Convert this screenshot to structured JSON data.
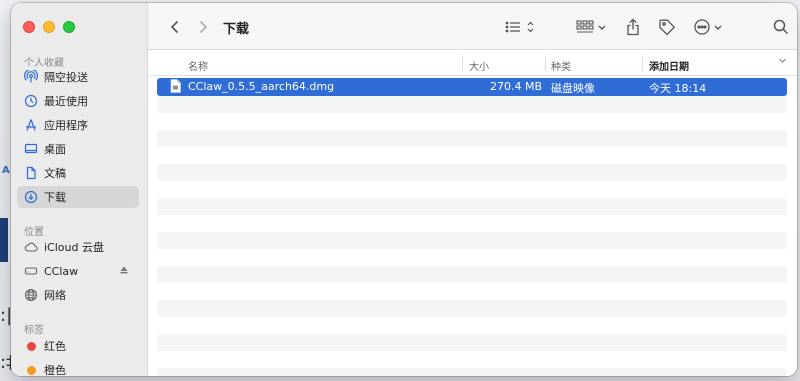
{
  "window": {
    "title": "下载",
    "back_icon": "chevron-left-icon",
    "forward_icon": "chevron-right-icon"
  },
  "sidebar": {
    "favorites_title": "个人收藏",
    "favorites": [
      {
        "label": "隔空投送",
        "icon": "airdrop-icon"
      },
      {
        "label": "最近使用",
        "icon": "clock-icon"
      },
      {
        "label": "应用程序",
        "icon": "applications-icon"
      },
      {
        "label": "桌面",
        "icon": "desktop-icon"
      },
      {
        "label": "文稿",
        "icon": "document-icon"
      },
      {
        "label": "下载",
        "icon": "download-icon",
        "selected": true
      }
    ],
    "locations_title": "位置",
    "locations": [
      {
        "label": "iCloud 云盘",
        "icon": "cloud-icon"
      },
      {
        "label": "CClaw",
        "icon": "disk-icon",
        "ejectable": true
      },
      {
        "label": "网络",
        "icon": "globe-icon"
      }
    ],
    "tags_title": "标签",
    "tags": [
      {
        "label": "红色",
        "color": "#e8453c"
      },
      {
        "label": "橙色",
        "color": "#f39c1f"
      }
    ]
  },
  "columns": {
    "name": "名称",
    "size": "大小",
    "kind": "种类",
    "date_added": "添加日期"
  },
  "files": [
    {
      "name": "CClaw_0.5.5_aarch64.dmg",
      "size": "270.4 MB",
      "kind": "磁盘映像",
      "date_added": "今天 18:14",
      "selected": true
    }
  ],
  "colors": {
    "selection": "#2f6cd6",
    "sidebar_bg": "#ebebeb",
    "toolbar_bg": "#f6f6f6"
  }
}
